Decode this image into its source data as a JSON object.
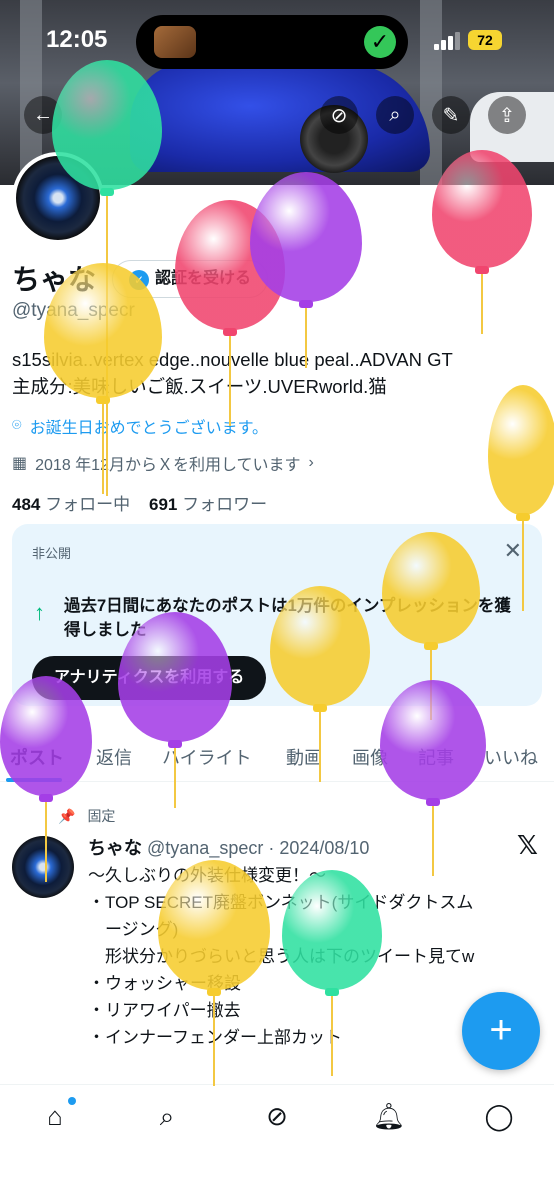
{
  "status_bar": {
    "time": "12:05",
    "battery": "72"
  },
  "profile": {
    "name": "ちゃな",
    "verify_label": "認証を受ける",
    "handle": "@tyana_specr",
    "bio_line1": "s15silvia..vertex edge..nouvelle blue peal..ADVAN GT",
    "bio_line2": "主成分:美味しいご飯.スイーツ.UVERworld.猫",
    "location": "お誕生日おめでとうございます。",
    "joined": "2018 年12月からＸを利用しています",
    "following_count": "484",
    "following_label": "フォロー中",
    "followers_count": "691",
    "followers_label": "フォロワー"
  },
  "analytics_card": {
    "private_label": "非公開",
    "message": "過去7日間にあなたのポストは1万件のインプレッションを獲得しました",
    "cta": "アナリティクスを利用する"
  },
  "tabs": [
    "ポスト",
    "返信",
    "ハイライト",
    "動画",
    "画像",
    "記事",
    "いいね"
  ],
  "pinned_tweet": {
    "pinned_label": "固定",
    "author": "ちゃな",
    "handle_date": "@tyana_specr · 2024/08/10",
    "lines": [
      "〜久しぶりの外装仕様変更！〜",
      "・TOP SECRET廃盤ボンネット(サイドダクトスム",
      "　ージング)",
      "　形状分かりづらいと思う人は下のツイート見てw",
      "・ウォッシャー移設",
      "・リアワイパー撤去",
      "・インナーフェンダー上部カット"
    ]
  },
  "icons": {
    "back": "back-arrow-icon",
    "grok": "grok-icon",
    "search": "search-icon",
    "edit": "pencil-icon",
    "share": "share-icon",
    "x": "x-logo-icon",
    "fab": "compose-plus-icon",
    "nav": [
      "home-icon",
      "search-icon",
      "grok-icon",
      "bell-icon",
      "messages-icon"
    ]
  },
  "colors": {
    "accent": "#1d9bf0",
    "balloon_green": "#2fe0a0",
    "balloon_red": "#f0456e",
    "balloon_purple": "#a43ee6",
    "balloon_yellow": "#f6cc2e"
  }
}
